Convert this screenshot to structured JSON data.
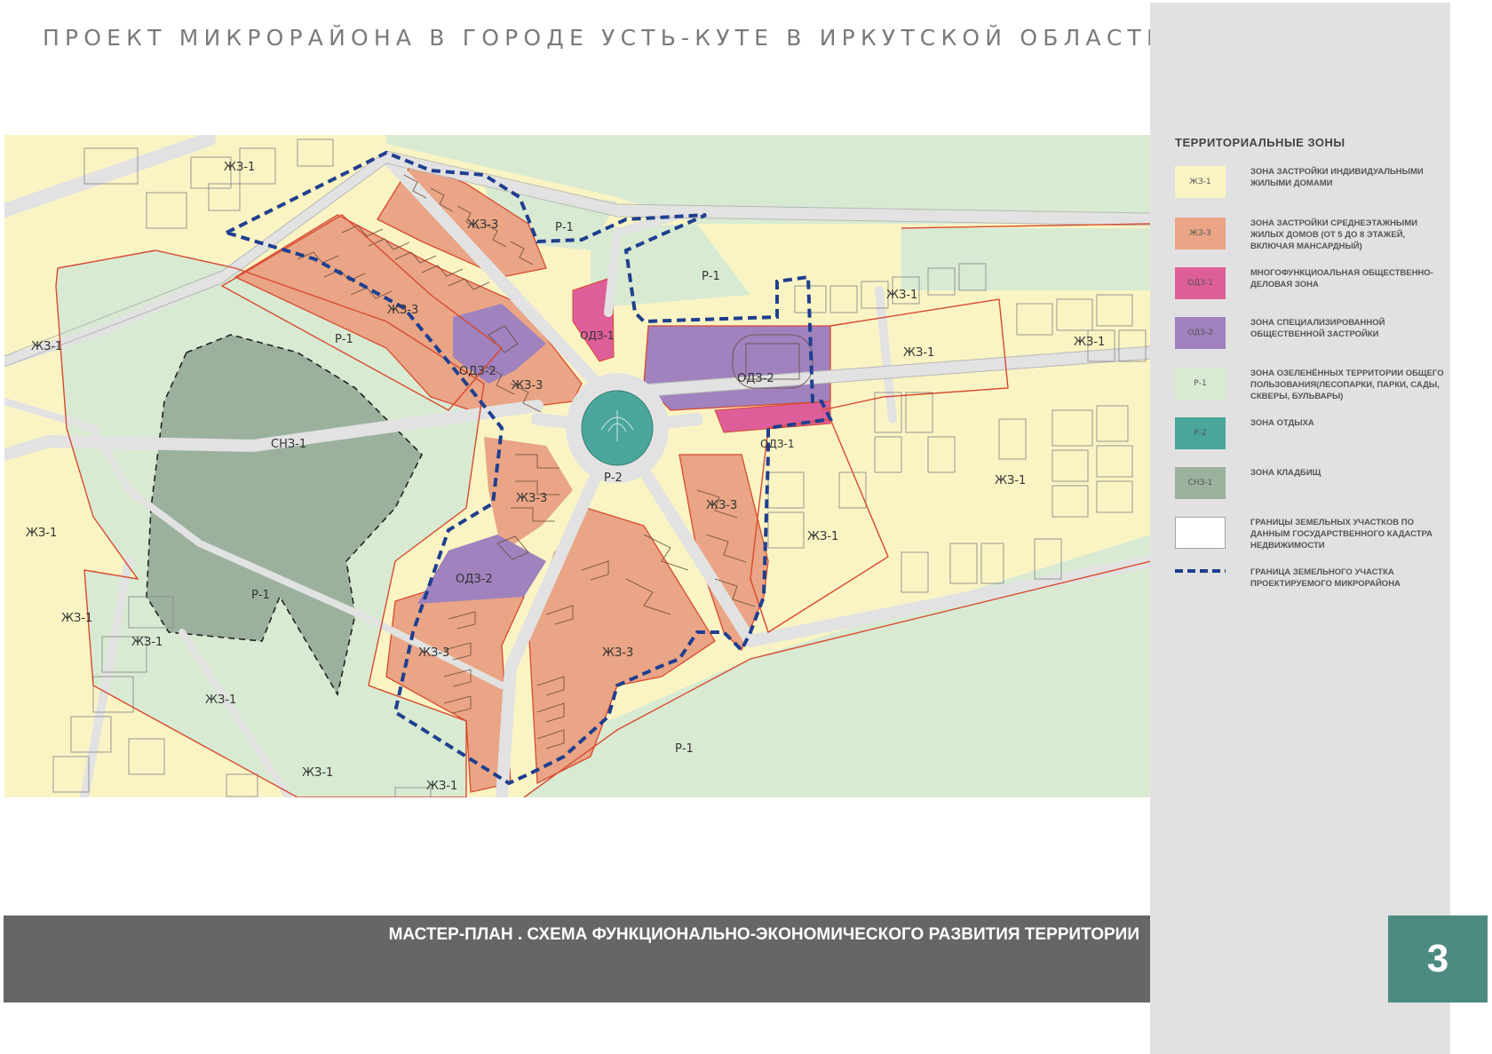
{
  "page_title": "ПРОЕКТ МИКРОРАЙОНА В ГОРОДЕ УСТЬ-КУТЕ В ИРКУТСКОЙ ОБЛАСТИ",
  "footer": {
    "title": "МАСТЕР-ПЛАН . СХЕМА ФУНКЦИОНАЛЬНО-ЭКОНОМИЧЕСКОГО РАЗВИТИЯ ТЕРРИТОРИИ",
    "page_number": "3"
  },
  "legend": {
    "title": "ТЕРРИТОРИАЛЬНЫЕ  ЗОНЫ",
    "items": [
      {
        "code": "ЖЗ-1",
        "text": "ЗОНА ЗАСТРОЙКИ ИНДИВИДУАЛЬНЫМИ ЖИЛЫМИ ДОМАМИ",
        "color": "#faf4c4"
      },
      {
        "code": "ЖЗ-3",
        "text": "ЗОНА ЗАСТРОЙКИ СРЕДНЕЭТАЖНЫМИ ЖИЛЫХ ДОМОВ (ОТ 5 ДО 8 ЭТАЖЕЙ, ВКЛЮЧАЯ МАНСАРДНЫЙ)",
        "color": "#e9a585"
      },
      {
        "code": "ОДЗ-1",
        "text": "МНОГОФУНКЦИОАЛЬНАЯ ОБЩЕСТВЕННО-ДЕЛОВАЯ ЗОНА",
        "color": "#dd5e98"
      },
      {
        "code": "ОДЗ-2",
        "text": "ЗОНА СПЕЦИАЛИЗИРОВАННОЙ ОБЩЕСТВЕННОЙ ЗАСТРОЙКИ",
        "color": "#9f82be"
      },
      {
        "code": "Р-1",
        "text": "ЗОНА ОЗЕЛЕНЁННЫХ ТЕРРИТОРИИ ОБЩЕГО ПОЛЬЗОВАНИЯ(ЛЕСОПАРКИ, ПАРКИ, САДЫ, СКВЕРЫ, БУЛЬВАРЫ)",
        "color": "#d9ead3"
      },
      {
        "code": "Р-2",
        "text": "ЗОНА ОТДЫХА",
        "color": "#4aa59a"
      },
      {
        "code": "СНЗ-1",
        "text": "ЗОНА КЛАДБИЩ",
        "color": "#9bb19e"
      },
      {
        "code": "",
        "text": "ГРАНИЦЫ ЗЕМЕЛЬНЫХ УЧАСТКОВ ПО ДАННЫМ ГОСУДАРСТВЕННОГО КАДАСТРА НЕДВИЖИМОСТИ",
        "color": "#ffffff"
      },
      {
        "code": "",
        "text": "ГРАНИЦА ЗЕМЕЛЬНОГО УЧАСТКА ПРОЕКТИРУЕМОГО  МИКРОРАЙОНА",
        "color": "#1f3f8f"
      }
    ]
  },
  "map_labels": {
    "zh1_a": "ЖЗ-1",
    "zh1_b": "ЖЗ-1",
    "zh1_c": "ЖЗ-1",
    "zh1_d": "ЖЗ-1",
    "zh1_e": "ЖЗ-1",
    "zh1_f": "ЖЗ-1",
    "zh1_g": "ЖЗ-1",
    "zh1_h": "ЖЗ-1",
    "zh1_i": "ЖЗ-1",
    "zh1_j": "ЖЗ-1",
    "zh1_k": "ЖЗ-1",
    "zh1_l": "ЖЗ-1",
    "zh1_m": "ЖЗ-1",
    "zh3_a": "ЖЗ-3",
    "zh3_b": "ЖЗ-3",
    "zh3_c": "ЖЗ-3",
    "zh3_d": "ЖЗ-3",
    "zh3_e": "ЖЗ-3",
    "zh3_f": "ЖЗ-3",
    "zh3_g": "ЖЗ-3",
    "odz1_a": "ОДЗ-1",
    "odz1_b": "ОДЗ-1",
    "odz2_a": "ОДЗ-2",
    "odz2_b": "ОДЗ-2",
    "odz2_c": "ОДЗ-2",
    "r1_a": "Р-1",
    "r1_b": "Р-1",
    "r1_c": "Р-1",
    "r1_d": "Р-1",
    "r1_e": "Р-1",
    "r2": "Р-2",
    "snz1": "СНЗ-1"
  }
}
